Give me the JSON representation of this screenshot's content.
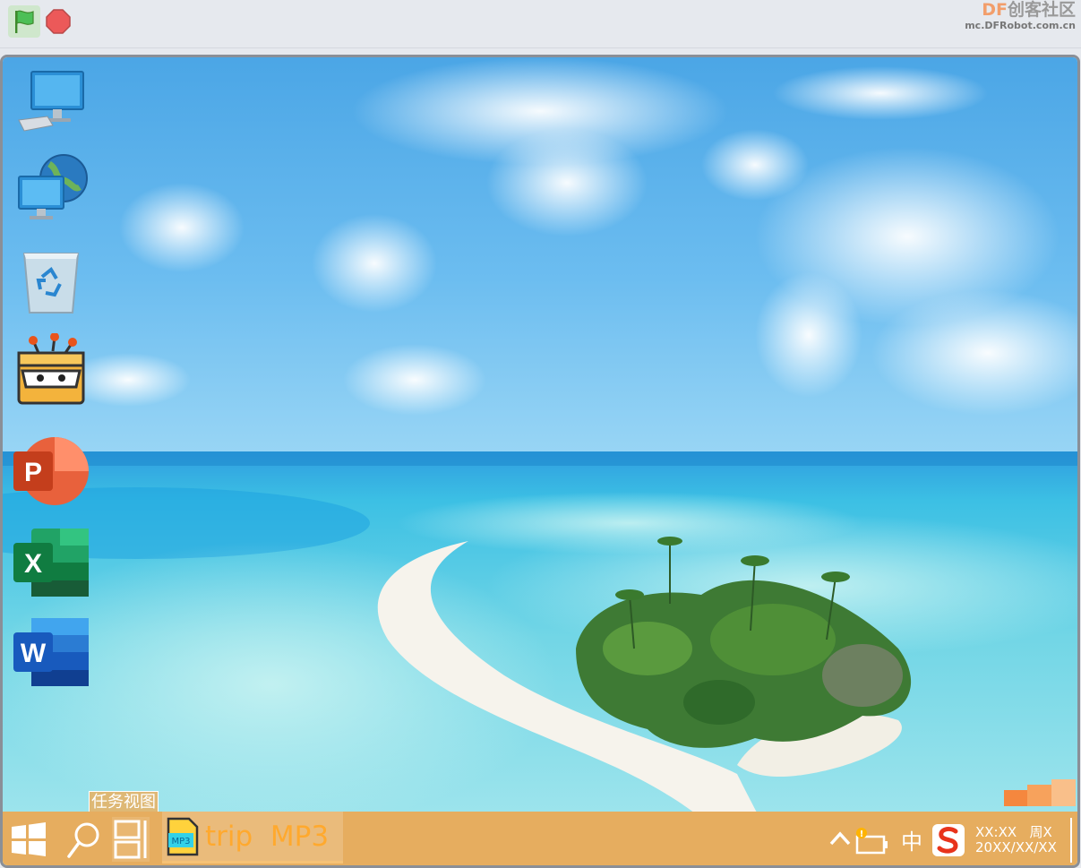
{
  "brand": {
    "prefix": "DF",
    "name": "创客社区",
    "url": "mc.DFRobot.com.cn"
  },
  "controls": {
    "green_flag": "green-flag-icon",
    "stop": "stop-icon"
  },
  "desktop_icons": [
    {
      "name": "this-pc-icon"
    },
    {
      "name": "network-icon"
    },
    {
      "name": "recycle-bin-icon"
    },
    {
      "name": "mind-plus-icon"
    },
    {
      "name": "powerpoint-icon",
      "letter": "P"
    },
    {
      "name": "excel-icon",
      "letter": "X"
    },
    {
      "name": "word-icon",
      "letter": "W"
    }
  ],
  "tooltip": {
    "text": "任务视图"
  },
  "taskbar": {
    "active_app": {
      "icon_label": "MP3",
      "label": "trip  MP3"
    },
    "tray": {
      "ime": "中",
      "time": "XX:XX   周X",
      "date": "20XX/XX/XX"
    }
  },
  "colors": {
    "taskbar": "#e6ad5f",
    "accent": "#ffa92e",
    "sky": "#5bb3ec",
    "sea": "#7fdbe3"
  }
}
